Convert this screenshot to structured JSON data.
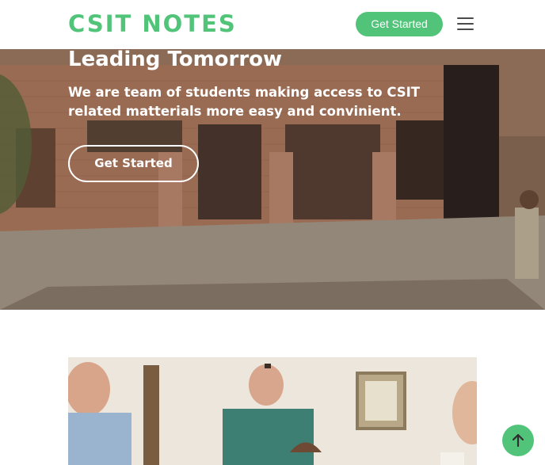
{
  "header": {
    "logo": "CSIT NOTES",
    "cta_label": "Get Started",
    "menu_icon": "hamburger-menu-icon"
  },
  "hero": {
    "title": "Leading Tomorrow",
    "subtitle": "We are team of students making access to CSIT related matterials more easy and convinient.",
    "button_label": "Get Started"
  },
  "back_to_top_icon": "arrow-up-icon",
  "colors": {
    "accent": "#52c47a",
    "text_dark": "#4a4a4a"
  }
}
